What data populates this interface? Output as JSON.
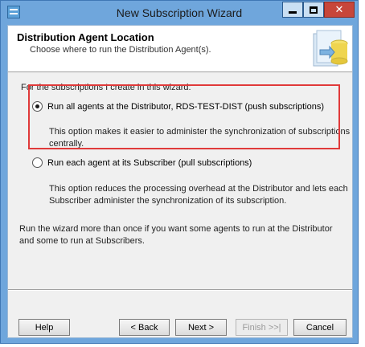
{
  "window": {
    "title": "New Subscription Wizard",
    "controls": {
      "minimize": "minimize",
      "maximize": "maximize",
      "close": "close"
    }
  },
  "header": {
    "title": "Distribution Agent Location",
    "subtitle": "Choose where to run the Distribution Agent(s)."
  },
  "options": {
    "group_label": "For the subscriptions I create in this wizard:",
    "push": {
      "label": "Run all agents at the Distributor, RDS-TEST-DIST (push subscriptions)",
      "description": "This option makes it easier to administer the synchronization of subscriptions centrally.",
      "selected": true
    },
    "pull": {
      "label": "Run each agent at its Subscriber (pull subscriptions)",
      "description_line1": "This option reduces the processing overhead at the Distributor and lets each",
      "description_line2": "Subscriber administer the synchronization of its subscription.",
      "selected": false
    }
  },
  "note": "Run the wizard more than once if you want some agents to run at the Distributor and some to run at Subscribers.",
  "buttons": {
    "help": "Help",
    "back": "< Back",
    "next": "Next >",
    "finish": "Finish >>|",
    "cancel": "Cancel"
  },
  "colors": {
    "highlight": "#e03a3a",
    "titlebar": "#6fa6dc",
    "close_button": "#c7463a"
  }
}
